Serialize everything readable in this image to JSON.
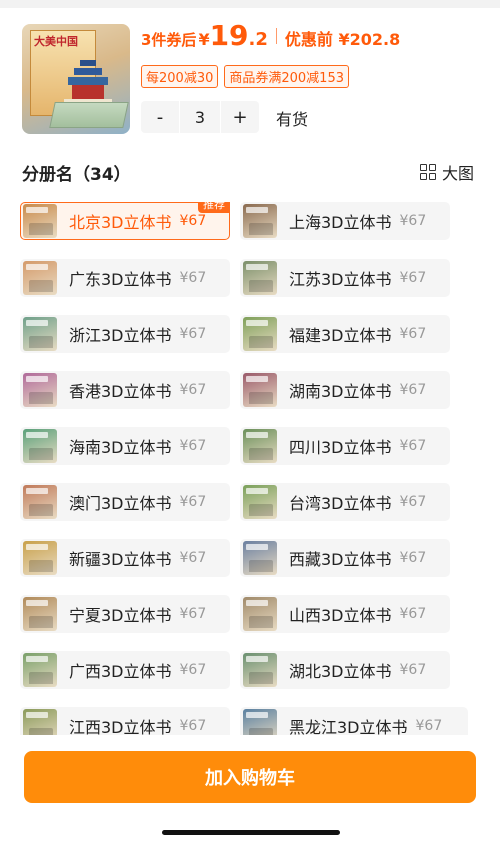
{
  "product": {
    "after_coupon_label": "3件券后",
    "currency": "¥",
    "price_int": "19",
    "price_dec": ".2",
    "before_label": "优惠前 ¥202.8",
    "cover_title": "大美中国"
  },
  "coupons": [
    "每200减30",
    "商品券满200减153"
  ],
  "quantity": {
    "minus": "-",
    "value": "3",
    "plus": "+"
  },
  "stock": "有货",
  "section": {
    "title": "分册名（34）",
    "view_label": "大图"
  },
  "variants": [
    {
      "name": "北京3D立体书",
      "price": "¥67",
      "badge": "推荐",
      "color": "#c98a4b"
    },
    {
      "name": "上海3D立体书",
      "price": "¥67",
      "color": "#8a6a4f"
    },
    {
      "name": "广东3D立体书",
      "price": "¥67",
      "color": "#d49a6a"
    },
    {
      "name": "江苏3D立体书",
      "price": "¥67",
      "color": "#7b8f6a"
    },
    {
      "name": "浙江3D立体书",
      "price": "¥67",
      "color": "#6fa08a"
    },
    {
      "name": "福建3D立体书",
      "price": "¥67",
      "color": "#7fa05a"
    },
    {
      "name": "香港3D立体书",
      "price": "¥67",
      "color": "#b06a9a"
    },
    {
      "name": "湖南3D立体书",
      "price": "¥67",
      "color": "#9a5a6a"
    },
    {
      "name": "海南3D立体书",
      "price": "¥67",
      "color": "#5aa07a"
    },
    {
      "name": "四川3D立体书",
      "price": "¥67",
      "color": "#6a8f5a"
    },
    {
      "name": "澳门3D立体书",
      "price": "¥67",
      "color": "#c07a5a"
    },
    {
      "name": "台湾3D立体书",
      "price": "¥67",
      "color": "#7aa05a"
    },
    {
      "name": "新疆3D立体书",
      "price": "¥67",
      "color": "#c8a04a"
    },
    {
      "name": "西藏3D立体书",
      "price": "¥67",
      "color": "#6a7fa0"
    },
    {
      "name": "宁夏3D立体书",
      "price": "¥67",
      "color": "#b08a5a"
    },
    {
      "name": "山西3D立体书",
      "price": "¥67",
      "color": "#a08a6a"
    },
    {
      "name": "广西3D立体书",
      "price": "¥67",
      "color": "#7aa06a"
    },
    {
      "name": "湖北3D立体书",
      "price": "¥67",
      "color": "#6a9070"
    },
    {
      "name": "江西3D立体书",
      "price": "¥67",
      "color": "#8a9a5a"
    },
    {
      "name": "黑龙江3D立体书",
      "price": "¥67",
      "color": "#5a80a0"
    }
  ],
  "cart_button": "加入购物车",
  "colors": {
    "accent": "#ff5a0a",
    "button": "#ff8c0a",
    "chip_bg": "#f5f5f5"
  }
}
